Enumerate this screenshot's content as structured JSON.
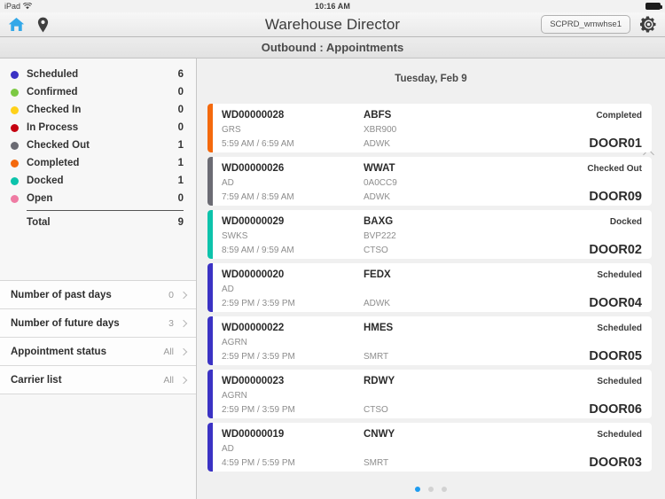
{
  "status_bar": {
    "device": "iPad",
    "wifi_icon": "wifi-icon",
    "time": "10:16 AM",
    "battery_icon": "battery-full-icon"
  },
  "nav": {
    "home_icon": "home-icon",
    "location_icon": "location-pin-icon",
    "title": "Warehouse Director",
    "environment": "SCPRD_wmwhse1",
    "settings_icon": "gear-icon",
    "home_icon_color": "#33a8e8"
  },
  "subheader": {
    "title": "Outbound : Appointments"
  },
  "sidebar": {
    "legend": {
      "items": [
        {
          "label": "Scheduled",
          "count": "6",
          "color": "#3b32c4"
        },
        {
          "label": "Confirmed",
          "count": "0",
          "color": "#7cc943"
        },
        {
          "label": "Checked In",
          "count": "0",
          "color": "#ffd11a"
        },
        {
          "label": "In Process",
          "count": "0",
          "color": "#c4000f"
        },
        {
          "label": "Checked Out",
          "count": "1",
          "color": "#6b6b73"
        },
        {
          "label": "Completed",
          "count": "1",
          "color": "#f4690d"
        },
        {
          "label": "Docked",
          "count": "1",
          "color": "#0cc3ab"
        },
        {
          "label": "Open",
          "count": "0",
          "color": "#ef7ba3"
        }
      ],
      "total_label": "Total",
      "total_count": "9"
    },
    "filters": [
      {
        "label": "Number of past days",
        "value": "0"
      },
      {
        "label": "Number of future days",
        "value": "3"
      },
      {
        "label": "Appointment status",
        "value": "All"
      },
      {
        "label": "Carrier list",
        "value": "All"
      }
    ]
  },
  "main": {
    "date_header": "Tuesday, Feb 9",
    "collapse_icon": "chevron-up-icon",
    "appointments": [
      {
        "id": "WD00000028",
        "owner": "GRS",
        "time": "5:59 AM / 6:59 AM",
        "carrier": "ABFS",
        "reference": "XBR900",
        "type": "ADWK",
        "status": "Completed",
        "door": "DOOR01",
        "color": "#f4690d"
      },
      {
        "id": "WD00000026",
        "owner": "AD",
        "time": "7:59 AM / 8:59 AM",
        "carrier": "WWAT",
        "reference": "0A0CC9",
        "type": "ADWK",
        "status": "Checked Out",
        "door": "DOOR09",
        "color": "#6b6b73"
      },
      {
        "id": "WD00000029",
        "owner": "SWKS",
        "time": "8:59 AM / 9:59 AM",
        "carrier": "BAXG",
        "reference": "BVP222",
        "type": "CTSO",
        "status": "Docked",
        "door": "DOOR02",
        "color": "#0cc3ab"
      },
      {
        "id": "WD00000020",
        "owner": "AD",
        "time": "2:59 PM / 3:59 PM",
        "carrier": "FEDX",
        "reference": "",
        "type": "ADWK",
        "status": "Scheduled",
        "door": "DOOR04",
        "color": "#3b32c4"
      },
      {
        "id": "WD00000022",
        "owner": "AGRN",
        "time": "2:59 PM / 3:59 PM",
        "carrier": "HMES",
        "reference": "",
        "type": "SMRT",
        "status": "Scheduled",
        "door": "DOOR05",
        "color": "#3b32c4"
      },
      {
        "id": "WD00000023",
        "owner": "AGRN",
        "time": "2:59 PM / 3:59 PM",
        "carrier": "RDWY",
        "reference": "",
        "type": "CTSO",
        "status": "Scheduled",
        "door": "DOOR06",
        "color": "#3b32c4"
      },
      {
        "id": "WD00000019",
        "owner": "AD",
        "time": "4:59 PM / 5:59 PM",
        "carrier": "CNWY",
        "reference": "",
        "type": "SMRT",
        "status": "Scheduled",
        "door": "DOOR03",
        "color": "#3b32c4"
      }
    ],
    "pager": {
      "total": 3,
      "active_index": 0,
      "active_color": "#1e9cf0"
    }
  }
}
